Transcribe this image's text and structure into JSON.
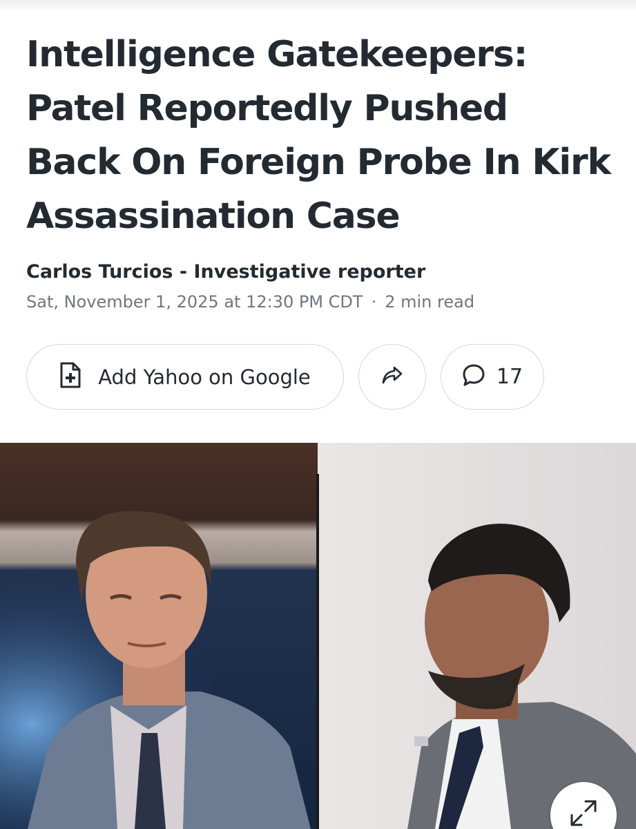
{
  "article": {
    "headline_lines": [
      "Intelligence Gatekeepers:",
      "Patel Reportedly Pushed",
      "Back On Foreign Probe In Kirk",
      "Assassination Case"
    ],
    "byline": "Carlos Turcios - Investigative reporter",
    "date": "Sat, November 1, 2025 at 12:30 PM CDT",
    "separator": "·",
    "read_time": "2 min read"
  },
  "actions": {
    "add_google_label": "Add Yahoo on Google",
    "add_google_icon": "document-plus-icon",
    "share_icon": "share-arrow-icon",
    "comment_icon": "speech-bubble-icon",
    "comment_count": "17"
  },
  "hero_image": {
    "expand_icon": "expand-arrows-icon"
  },
  "colors": {
    "text_primary": "#232a31",
    "text_secondary": "#6e7780",
    "pill_border": "#d4d7da"
  }
}
